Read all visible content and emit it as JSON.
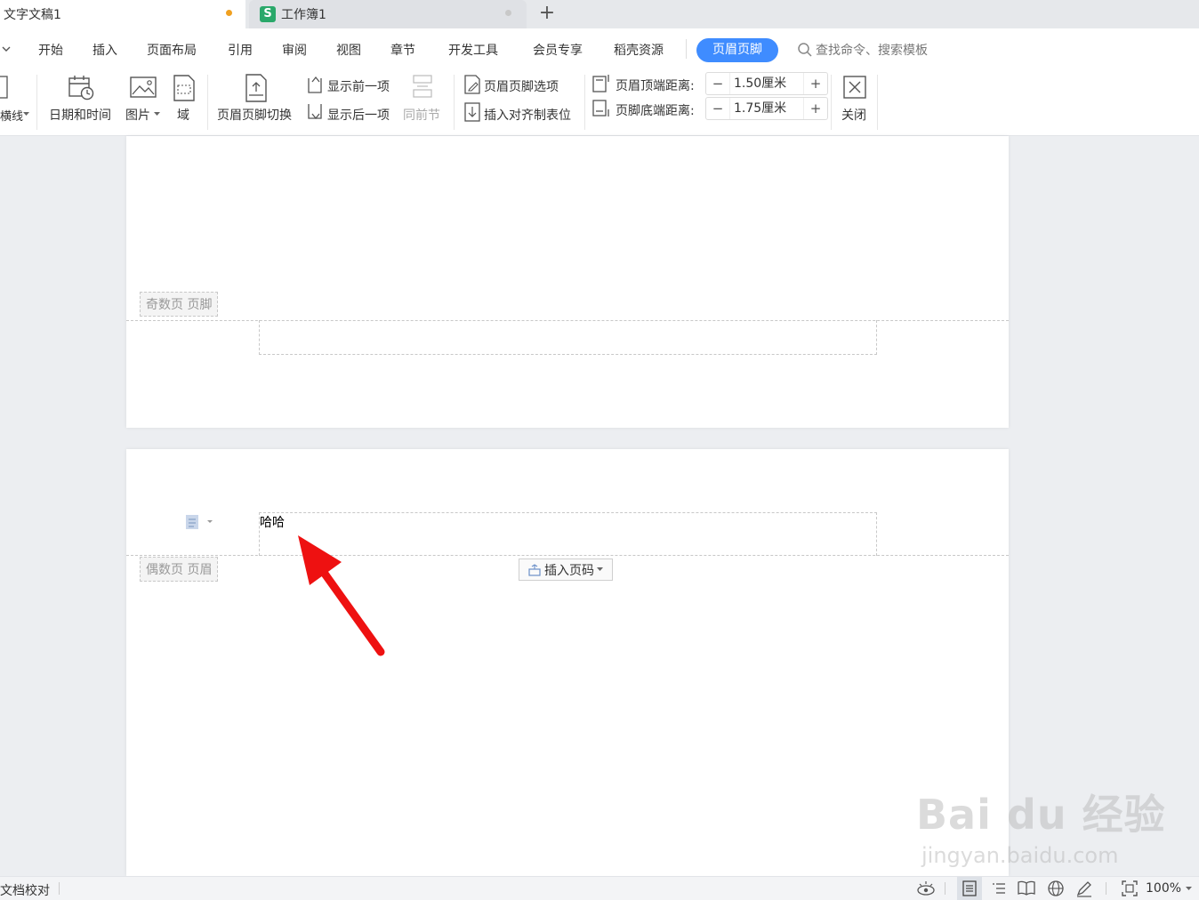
{
  "tabs": [
    {
      "label": "文字文稿1",
      "dot_color": "#f0a020"
    },
    {
      "label": "工作簿1",
      "dot_color": "#c8c8c8",
      "logo": "S"
    }
  ],
  "new_tab": "+",
  "menu": {
    "items": [
      "开始",
      "插入",
      "页面布局",
      "引用",
      "审阅",
      "视图",
      "章节",
      "开发工具",
      "会员专享",
      "稻壳资源"
    ],
    "active": "页眉页脚",
    "search_placeholder": "查找命令、搜索模板"
  },
  "ribbon": {
    "cut_label": "横线",
    "datetime": "日期和时间",
    "picture": "图片",
    "field": "域",
    "switch": "页眉页脚切换",
    "prev": "显示前一项",
    "next": "显示后一项",
    "same_prev": "同前节",
    "options": "页眉页脚选项",
    "align_tab": "插入对齐制表位",
    "top_dist_label": "页眉顶端距离:",
    "top_dist_value": "1.50厘米",
    "bottom_dist_label": "页脚底端距离:",
    "bottom_dist_value": "1.75厘米",
    "close": "关闭"
  },
  "document": {
    "odd_footer_label": "奇数页 页脚",
    "even_header_label": "偶数页 页眉",
    "header_text": "哈哈",
    "insert_page_number": "插入页码"
  },
  "status": {
    "left": "文档校对",
    "zoom": "100%"
  },
  "watermark": {
    "main": "Bai du 经验",
    "sub": "jingyan.baidu.com"
  },
  "colors": {
    "accent": "#3f8cff",
    "arrow": "#ee1111"
  }
}
